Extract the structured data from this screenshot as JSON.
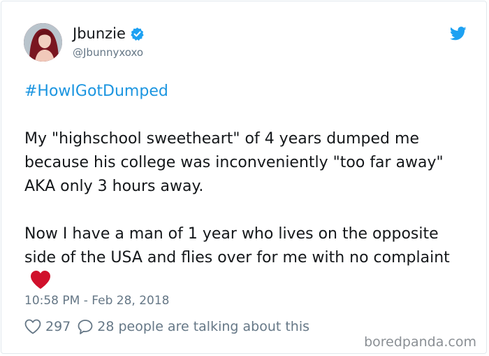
{
  "author": {
    "name": "Jbunzie",
    "handle": "@Jbunnyxoxo",
    "verified": true
  },
  "tweet": {
    "hashtag": "#HowIGotDumped",
    "paragraph1": "My \"highschool sweetheart\" of 4 years dumped me because his college was inconveniently \"too far away\" AKA only 3 hours away.",
    "paragraph2": "Now I have a man of 1 year who lives on the opposite side of the USA and flies over for me with no complaint",
    "emoji": "red-heart",
    "timestamp": "10:58 PM - Feb 28, 2018"
  },
  "engagement": {
    "likes": "297",
    "replies_text": "28 people are talking about this"
  },
  "watermark": "boredpanda.com",
  "colors": {
    "link": "#1b95e0",
    "muted": "#657786",
    "text": "#14171a",
    "verified": "#1da1f2",
    "heart": "#d0102b"
  },
  "icons": {
    "verified": "verified-badge-icon",
    "platform": "twitter-bird-icon",
    "like": "heart-outline-icon",
    "reply": "speech-bubble-icon"
  }
}
